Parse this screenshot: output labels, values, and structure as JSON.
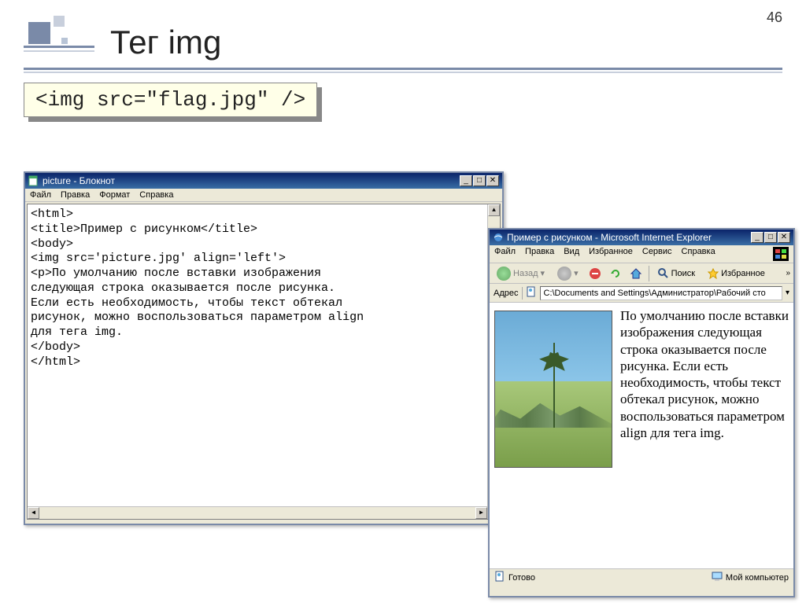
{
  "page_number": "46",
  "title": "Тег img",
  "code_example": "<img src=\"flag.jpg\" />",
  "notepad": {
    "title": "picture - Блокнот",
    "menu": [
      "Файл",
      "Правка",
      "Формат",
      "Справка"
    ],
    "code_lines": [
      "<html>",
      "<title>Пример с рисунком</title>",
      "<body>",
      "<img src='picture.jpg' align='left'>",
      "<p>По умолчанию после вставки изображения",
      "следующая строка оказывается после рисунка.",
      "Если есть необходимость, чтобы текст обтекал",
      "рисунок, можно воспользоваться параметром align",
      "для тега img.",
      "</body>",
      "</html>"
    ]
  },
  "ie": {
    "title": "Пример с рисунком - Microsoft Internet Explorer",
    "menu": [
      "Файл",
      "Правка",
      "Вид",
      "Избранное",
      "Сервис",
      "Справка"
    ],
    "back_label": "Назад",
    "search_label": "Поиск",
    "favorites_label": "Избранное",
    "address_label": "Адрес",
    "address_value": "C:\\Documents and Settings\\Администратор\\Рабочий сто",
    "body_text": "По умолчанию после вставки изображения следующая строка оказывается после рисунка. Если есть необходимость, чтобы текст обтекал рисунок, можно воспользоваться параметром align для тега img.",
    "status_ready": "Готово",
    "status_zone": "Мой компьютер"
  },
  "win_buttons": {
    "min": "_",
    "max": "□",
    "close": "✕"
  }
}
